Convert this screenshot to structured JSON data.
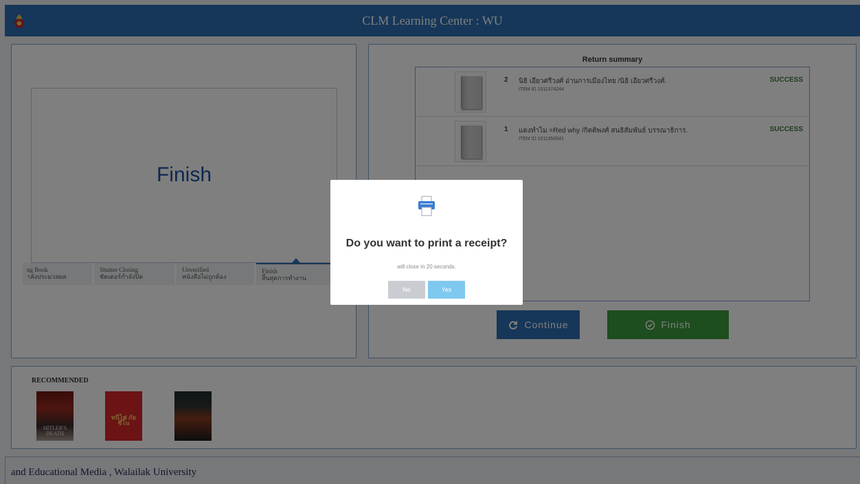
{
  "header": {
    "title": "CLM Learning Center : WU"
  },
  "stage": {
    "title": "Finish",
    "steps": [
      {
        "en": "ng Book",
        "th": "าลังประมวลผล"
      },
      {
        "en": "Shutter Closing",
        "th": "ชัตเตอร์กำลังปิด"
      },
      {
        "en": "Unverified",
        "th": "หนังสือไม่ถูกต้อง"
      },
      {
        "en": "Finish",
        "th": "สิ้นสุดการทำงาน"
      }
    ]
  },
  "summary": {
    "title": "Return summary",
    "items": [
      {
        "num": "2",
        "title": "นิธิ เอียวศรีวงศ์ อ่านการเมืองไทย /นิธิ เอียวศรีวงศ์.",
        "item_id": "ITEM ID  1011374244",
        "status": "SUCCESS"
      },
      {
        "num": "1",
        "title": "แดงทำไม =Red why /กิตติพงศ์ สนธิสัมพันธ์ บรรณาธิการ.",
        "item_id": "ITEM ID  1011350541",
        "status": "SUCCESS"
      }
    ],
    "continue_label": "Continue",
    "finish_label": "Finish"
  },
  "recommended": {
    "title": "RECOMMENDED",
    "covers": [
      {
        "text": "HITLER'S DEATH"
      },
      {
        "text": "หนีไฟ ภัย ซีโน"
      },
      {
        "text": ""
      }
    ]
  },
  "footer": {
    "text": "and Educational Media , Walailak University"
  },
  "modal": {
    "question": "Do you want to print a receipt?",
    "countdown": "will close in 20 seconds.",
    "no_label": "No",
    "yes_label": "Yes"
  },
  "colors": {
    "primary": "#2d6fb3",
    "success": "#3c9a3e",
    "status_text": "#3a7a3a"
  },
  "icons": {
    "logo": "university-seal-icon",
    "continue": "refresh-icon",
    "finish": "check-circle-icon",
    "print": "printer-icon"
  }
}
